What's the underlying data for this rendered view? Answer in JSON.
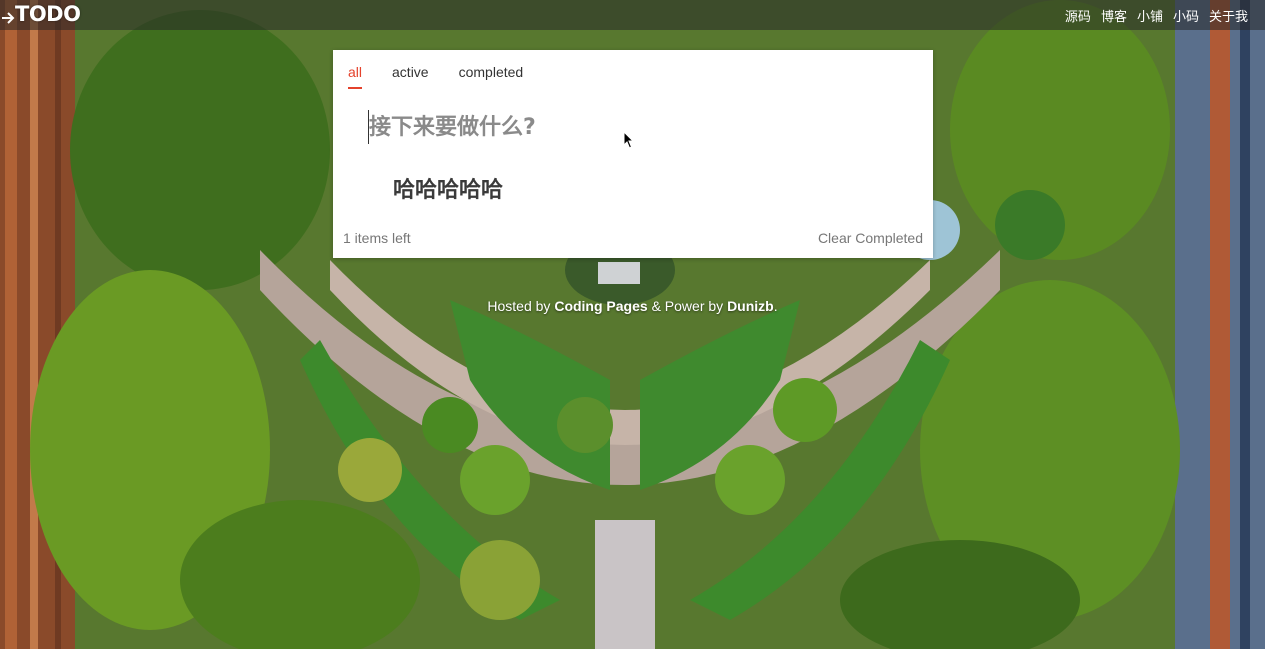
{
  "header": {
    "logo": "TODO",
    "nav": [
      "源码",
      "博客",
      "小铺",
      "小码",
      "关于我"
    ]
  },
  "tabs": [
    {
      "label": "all",
      "active": true
    },
    {
      "label": "active",
      "active": false
    },
    {
      "label": "completed",
      "active": false
    }
  ],
  "input": {
    "placeholder": "接下来要做什么?",
    "value": ""
  },
  "todos": [
    {
      "text": "哈哈哈哈哈",
      "completed": false
    }
  ],
  "footer": {
    "items_left": "1 items left",
    "clear_completed": "Clear Completed"
  },
  "credit": {
    "hosted_by": "Hosted by",
    "host_name": "Coding Pages",
    "power_by": "& Power by",
    "author": "Dunizb",
    "end": "."
  },
  "colors": {
    "accent": "#e4422c",
    "header_bg": "#282828"
  },
  "icons": {
    "sidebar_toggle": "arrow-right-icon",
    "mouse": "mouse-pointer-icon"
  }
}
